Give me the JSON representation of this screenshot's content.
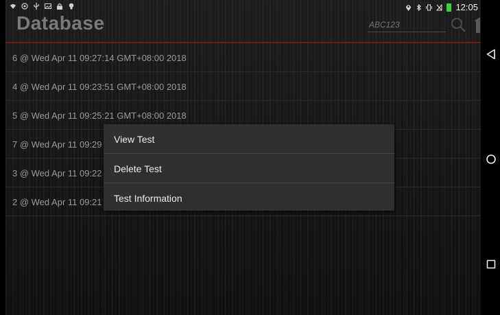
{
  "status_bar": {
    "left_icons": [
      "signal-icon",
      "location-icon",
      "usb-icon",
      "image-icon",
      "lock-icon",
      "bulb-icon"
    ],
    "right_icons": [
      "location-pin-icon",
      "bluetooth-icon",
      "vibrate-icon",
      "no-sim-icon",
      "battery-icon"
    ],
    "time": "12:05"
  },
  "header": {
    "title": "Database",
    "search_placeholder": "ABC123"
  },
  "list": {
    "items": [
      "6 @ Wed Apr 11 09:27:14 GMT+08:00 2018",
      "4 @ Wed Apr 11 09:23:51 GMT+08:00 2018",
      "5 @ Wed Apr 11 09:25:21 GMT+08:00 2018",
      "7 @ Wed Apr 11 09:29",
      "3 @ Wed Apr 11 09:22",
      "2 @ Wed Apr 11 09:21"
    ]
  },
  "context_menu": {
    "items": [
      "View Test",
      "Delete Test",
      "Test Information"
    ]
  },
  "navigation": {
    "buttons": [
      "back-icon",
      "home-icon",
      "recents-icon"
    ]
  },
  "colors": {
    "accent": "#7a1515",
    "battery": "#3bd23b"
  }
}
